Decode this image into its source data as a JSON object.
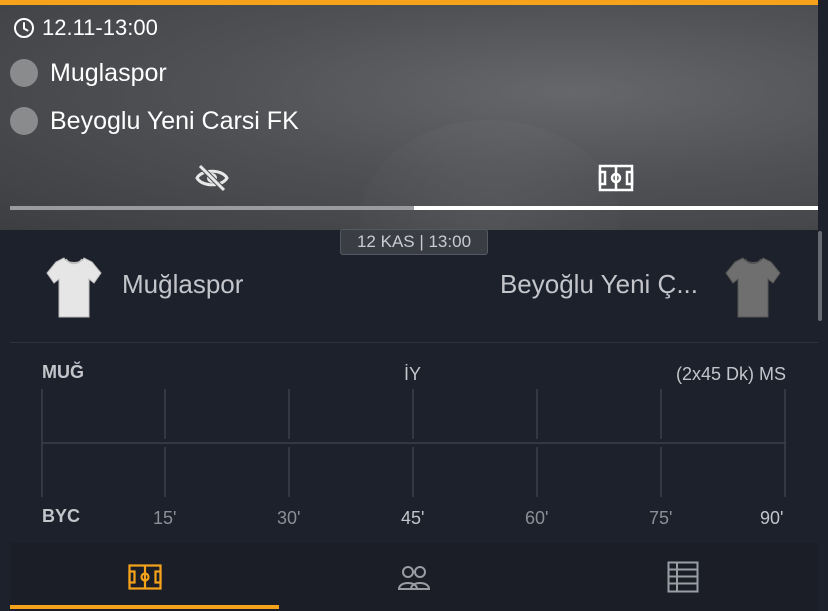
{
  "header": {
    "time": "12.11-13:00",
    "home_team": "Muglaspor",
    "away_team": "Beyoglu Yeni Carsi FK",
    "tabs": [
      {
        "icon": "eye-off-icon",
        "active": false
      },
      {
        "icon": "pitch-icon",
        "active": true
      }
    ]
  },
  "match": {
    "date_badge": "12 KAS | 13:00",
    "home_name": "Muğlaspor",
    "away_name": "Beyoğlu Yeni Ç...",
    "home_jersey_color": "#e6e6e6",
    "away_jersey_color": "#6f6f6f"
  },
  "timeline": {
    "home_abbr": "MUĞ",
    "away_abbr": "BYC",
    "half_label": "İY",
    "full_label": "(2x45 Dk) MS",
    "ticks": [
      "15'",
      "30'",
      "45'",
      "60'",
      "75'",
      "90'"
    ]
  },
  "bottom_nav": [
    {
      "icon": "pitch-icon",
      "active": true
    },
    {
      "icon": "lineup-icon",
      "active": false
    },
    {
      "icon": "table-icon",
      "active": false
    }
  ],
  "colors": {
    "accent": "#f6a31b",
    "panel_bg": "#1d212b",
    "text_muted": "#c3c5cb"
  }
}
